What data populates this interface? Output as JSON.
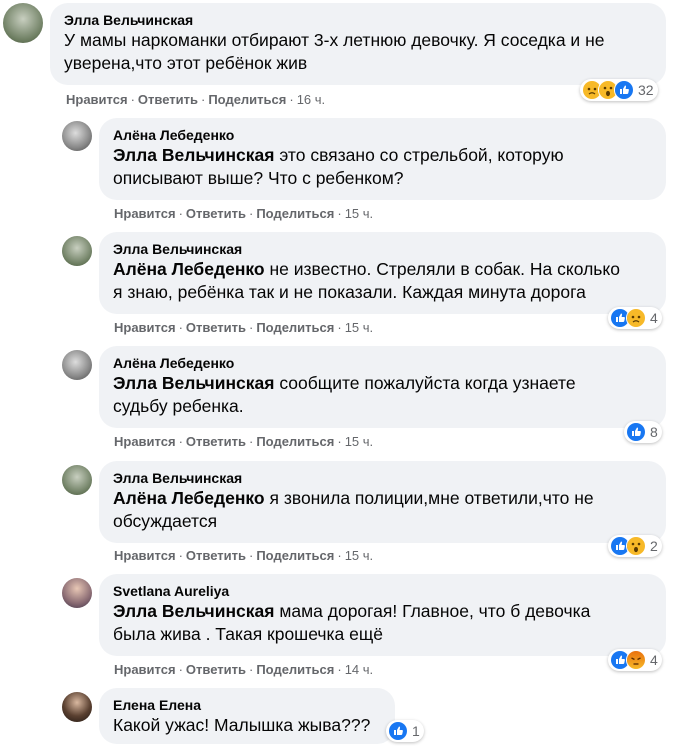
{
  "actions": {
    "like": "Нравится",
    "reply": "Ответить",
    "share": "Поделиться"
  },
  "comments": [
    {
      "author": "Элла Вельчинская",
      "mention": "",
      "text1": "У мамы наркоманки отбирают 3-х летнюю девочку. Я соседка и не",
      "text2": "уверена,что этот ребёнок жив",
      "time": "16 ч.",
      "reactions": [
        "sad",
        "wow",
        "like"
      ],
      "count": "32"
    },
    {
      "author": "Алёна Лебеденко",
      "mention": "Элла Вельчинская",
      "text1": "это связано со стрельбой, которую",
      "text2": "описывают выше? Что с ребенком?",
      "time": "15 ч.",
      "reactions": [],
      "count": ""
    },
    {
      "author": "Элла Вельчинская",
      "mention": "Алёна Лебеденко",
      "text1": "не известно. Стреляли в собак. На сколько",
      "text2": "я знаю, ребёнка так и не показали. Каждая минута дорога",
      "time": "15 ч.",
      "reactions": [
        "like",
        "sad"
      ],
      "count": "4"
    },
    {
      "author": "Алёна Лебеденко",
      "mention": "Элла Вельчинская",
      "text1": "сообщите пожалуйста когда узнаете",
      "text2": "судьбу ребенка.",
      "time": "15 ч.",
      "reactions": [
        "like"
      ],
      "count": "8"
    },
    {
      "author": "Элла Вельчинская",
      "mention": "Алёна Лебеденко",
      "text1": "я звонила полиции,мне ответили,что не",
      "text2": "обсуждается",
      "time": "15 ч.",
      "reactions": [
        "like",
        "wow"
      ],
      "count": "2"
    },
    {
      "author": "Svetlana Aureliya",
      "mention": "Элла Вельчинская",
      "text1": "мама дорогая! Главное, что б девочка",
      "text2": "была жива . Такая крошечка ещё",
      "time": "14 ч.",
      "reactions": [
        "like",
        "angry"
      ],
      "count": "4"
    },
    {
      "author": "Елена Елена",
      "mention": "",
      "text1": "Какой ужас! Малышка жыва???",
      "text2": "",
      "time": "",
      "reactions": [
        "like"
      ],
      "count": "1"
    }
  ],
  "colors": {
    "bubble": "#f0f2f5",
    "like": "#1877f2",
    "reaction_yellow": "#f7b928",
    "angry": "#e9710f"
  }
}
